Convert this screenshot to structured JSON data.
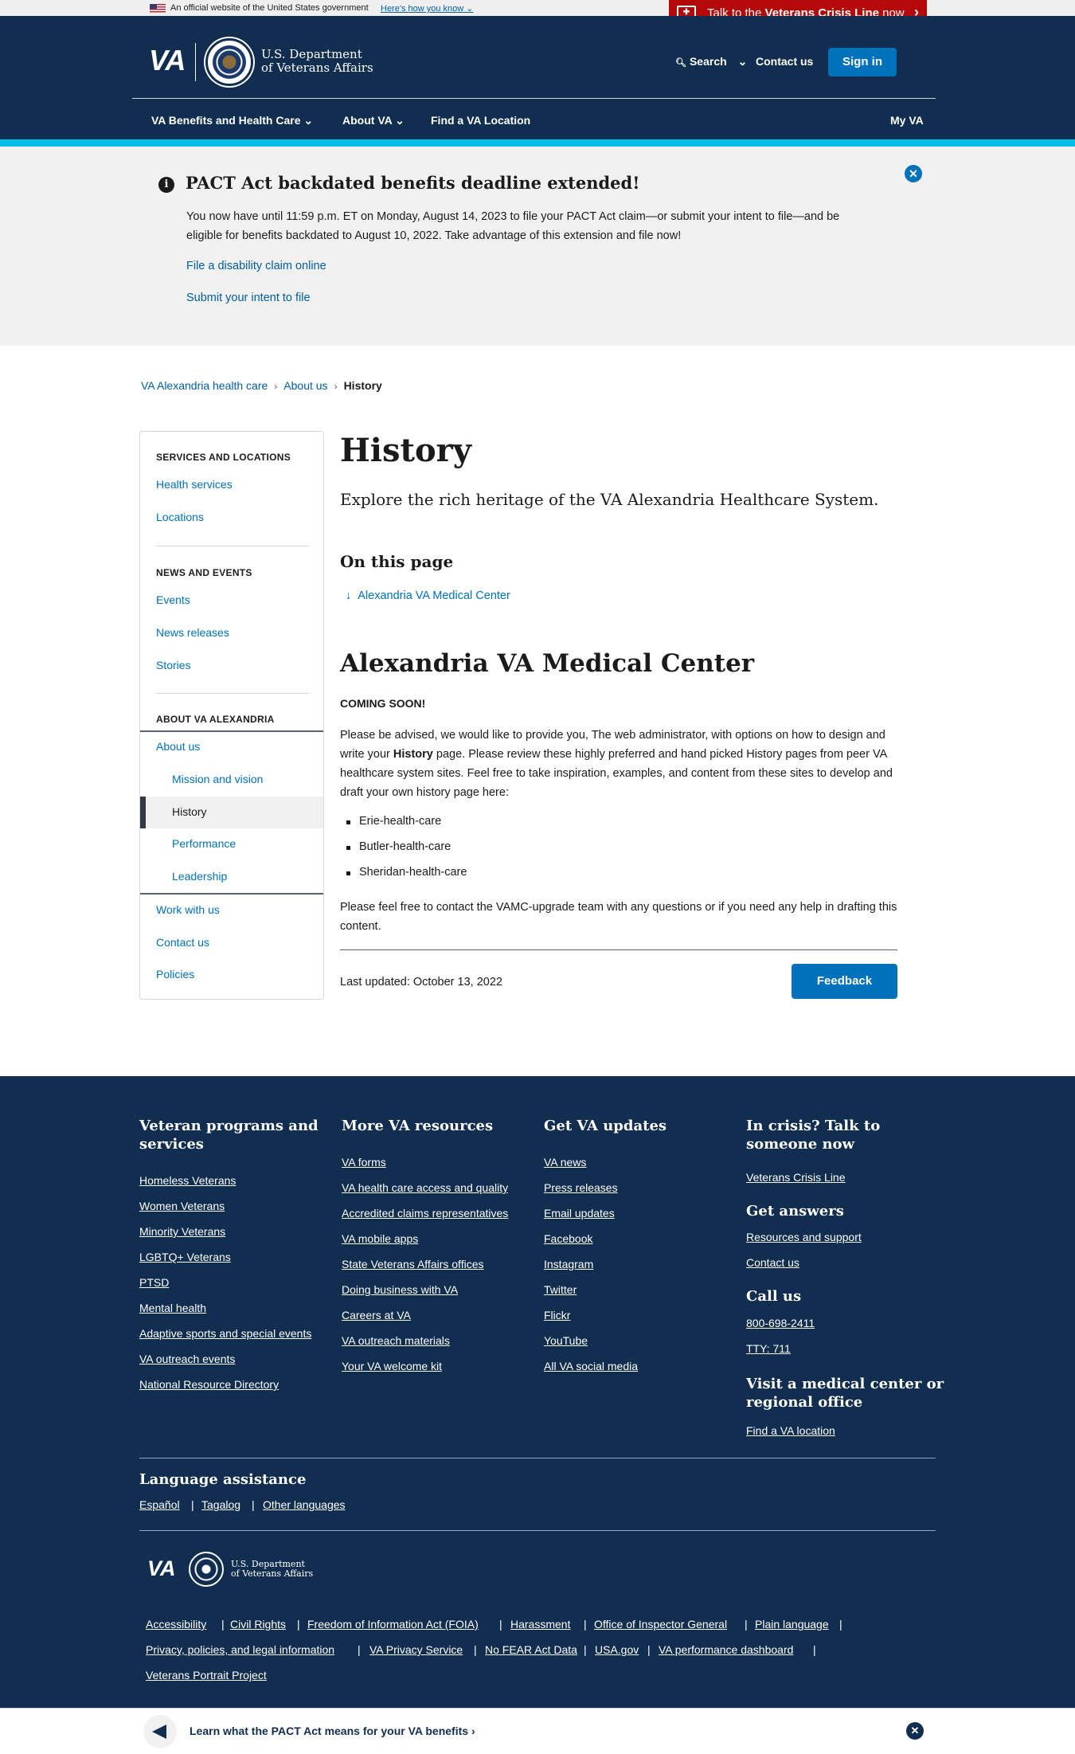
{
  "gov_banner": {
    "text": "An official website of the United States government",
    "link": "Here's how you know"
  },
  "crisis": {
    "prefix": "Talk to the ",
    "bold": "Veterans Crisis Line",
    "suffix": " now"
  },
  "header": {
    "logo": "VA",
    "dept_line1": "U.S. Department",
    "dept_line2": "of Veterans Affairs",
    "search": "Search",
    "contact": "Contact us",
    "signin": "Sign in",
    "nav": [
      "VA Benefits and Health Care",
      "About VA",
      "Find a VA Location",
      "My VA"
    ]
  },
  "alert": {
    "title": "PACT Act backdated benefits deadline extended!",
    "body": "You now have until 11:59 p.m. ET on Monday, August 14, 2023 to file your PACT Act claim—or submit your intent to file—and be eligible for benefits backdated to August 10, 2022. Take advantage of this extension and file now!",
    "link1": "File a disability claim online",
    "link2": "Submit your intent to file"
  },
  "breadcrumb": {
    "item1": "VA Alexandria health care",
    "item2": "About us",
    "current": "History"
  },
  "sidebar": {
    "sec1": "SERVICES AND LOCATIONS",
    "health": "Health services",
    "locations": "Locations",
    "sec2": "NEWS AND EVENTS",
    "events": "Events",
    "news": "News releases",
    "stories": "Stories",
    "sec3": "ABOUT VA ALEXANDRIA",
    "about": "About us",
    "mission": "Mission and vision",
    "history": "History",
    "performance": "Performance",
    "leadership": "Leadership",
    "work": "Work with us",
    "contact": "Contact us",
    "policies": "Policies"
  },
  "main": {
    "title": "History",
    "intro": "Explore the rich heritage of the VA Alexandria Healthcare System.",
    "on_this_page": "On this page",
    "otp_link": "Alexandria VA Medical Center",
    "section_title": "Alexandria VA Medical Center",
    "coming_soon": "COMING SOON!",
    "para1_a": "Please be advised, we would like to provide you, The web administrator, with options on how to design and write your ",
    "para1_bold": "History",
    "para1_b": " page. Please review these highly preferred and hand picked History pages from peer VA healthcare system sites.  Feel free to take inspiration, examples, and content from these sites to develop and draft your own history page here:",
    "bullets": [
      "Erie-health-care",
      "Butler-health-care",
      "Sheridan-health-care"
    ],
    "para2": "Please feel free to contact the VAMC-upgrade team with any questions or if you need any help in drafting this content.",
    "last_updated": "Last updated: October 13, 2022",
    "feedback": "Feedback"
  },
  "footer": {
    "col1_title": "Veteran programs and services",
    "col1": [
      "Homeless Veterans",
      "Women Veterans",
      "Minority Veterans",
      "LGBTQ+ Veterans",
      "PTSD",
      "Mental health",
      "Adaptive sports and special events",
      "VA outreach events",
      "National Resource Directory"
    ],
    "col2_title": "More VA resources",
    "col2": [
      "VA forms",
      "VA health care access and quality",
      "Accredited claims representatives",
      "VA mobile apps",
      "State Veterans Affairs offices",
      "Doing business with VA",
      "Careers at VA",
      "VA outreach materials",
      "Your VA welcome kit"
    ],
    "col3_title": "Get VA updates",
    "col3": [
      "VA news",
      "Press releases",
      "Email updates",
      "Facebook",
      "Instagram",
      "Twitter",
      "Flickr",
      "YouTube",
      "All VA social media"
    ],
    "crisis_title": "In crisis? Talk to someone now",
    "crisis_link": "Veterans Crisis Line",
    "answers_title": "Get answers",
    "answers": [
      "Resources and support",
      "Contact us"
    ],
    "call_title": "Call us",
    "call": [
      "800-698-2411",
      "TTY: 711"
    ],
    "visit_title": "Visit a medical center or regional office",
    "visit_link": "Find a VA location",
    "lang_title": "Language assistance",
    "langs": [
      "Español",
      "Tagalog",
      "Other languages"
    ],
    "logo": "VA",
    "dept_line1": "U.S. Department",
    "dept_line2": "of Veterans Affairs",
    "bottom_row1": [
      "Accessibility",
      "Civil Rights",
      "Freedom of Information Act (FOIA)",
      "Harassment",
      "Office of Inspector General",
      "Plain language"
    ],
    "bottom_row2": [
      "Privacy, policies, and legal information",
      "VA Privacy Service",
      "No FEAR Act Data",
      "USA.gov",
      "VA performance dashboard"
    ],
    "bottom_row3": [
      "Veterans Portrait Project"
    ]
  },
  "promo": {
    "text": "Learn what the PACT Act means for your VA benefits"
  }
}
